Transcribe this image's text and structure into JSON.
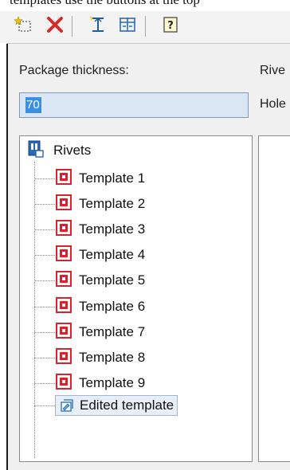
{
  "caption": {
    "text": "templates use the buttons at the top"
  },
  "toolbar": {
    "buttons": [
      {
        "icon": "new-template-icon"
      },
      {
        "icon": "delete-icon",
        "color": "#d42b2b"
      },
      {
        "icon": "edit-thickness-icon"
      },
      {
        "icon": "edit-columns-icon"
      },
      {
        "icon": "help-icon"
      }
    ]
  },
  "form": {
    "package_thickness_label": "Package thickness:",
    "package_thickness_value": "70",
    "rivets_label": "Rive",
    "hole_label": "Hole"
  },
  "tree": {
    "root": {
      "label": "Rivets",
      "icon": "rivets-folder-icon"
    },
    "items": [
      {
        "label": "Template 1",
        "icon": "template-icon"
      },
      {
        "label": "Template 2",
        "icon": "template-icon"
      },
      {
        "label": "Template 3",
        "icon": "template-icon"
      },
      {
        "label": "Template 4",
        "icon": "template-icon"
      },
      {
        "label": "Template 5",
        "icon": "template-icon"
      },
      {
        "label": "Template 6",
        "icon": "template-icon"
      },
      {
        "label": "Template 7",
        "icon": "template-icon"
      },
      {
        "label": "Template 8",
        "icon": "template-icon"
      },
      {
        "label": "Template 9",
        "icon": "template-icon"
      }
    ],
    "edited": {
      "label": "Edited template",
      "icon": "edited-template-icon",
      "selected": true
    }
  },
  "colors": {
    "template_red": "#e0202a",
    "selection_blue": "#3c8fe0"
  }
}
